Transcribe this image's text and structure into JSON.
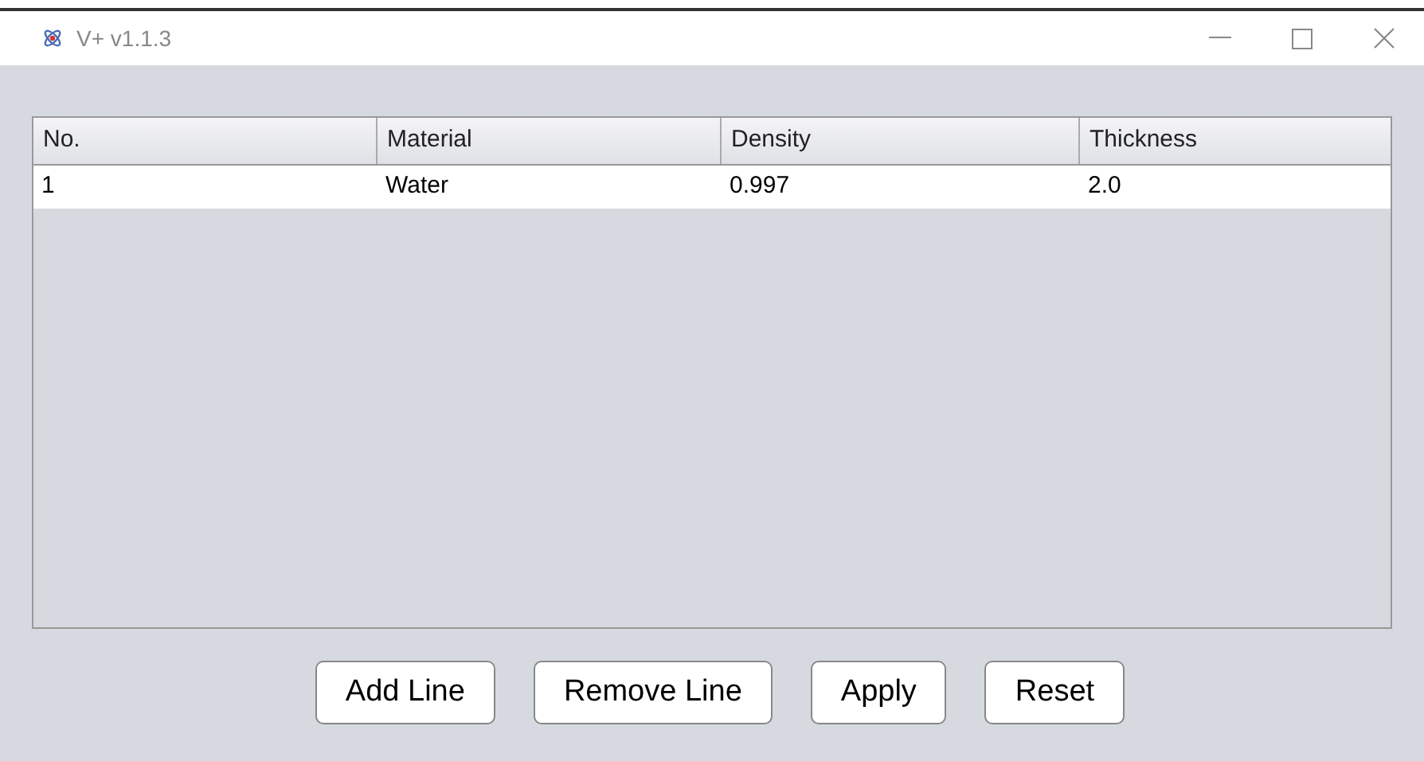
{
  "window": {
    "title": "V+ v1.1.3"
  },
  "table": {
    "columns": [
      "No.",
      "Material",
      "Density",
      "Thickness"
    ],
    "rows": [
      [
        "1",
        "Water",
        "0.997",
        "2.0"
      ]
    ]
  },
  "buttons": [
    "Add Line",
    "Remove Line",
    "Apply",
    "Reset"
  ]
}
